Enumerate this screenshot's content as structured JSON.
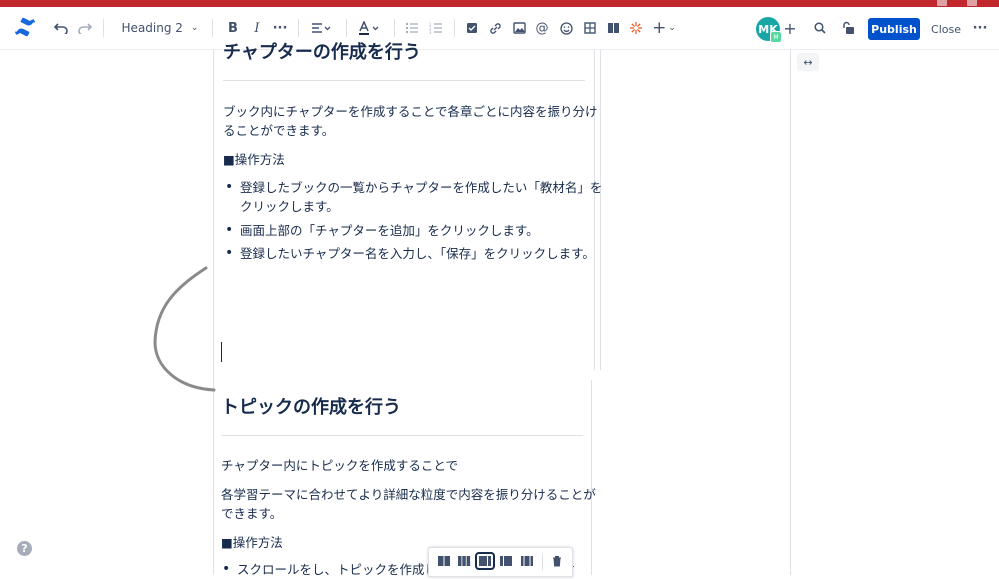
{
  "toolbar": {
    "heading_style": "Heading 2",
    "publish_label": "Publish",
    "close_label": "Close",
    "avatar_initials": "MK",
    "avatar_badge": "M"
  },
  "content": {
    "section1_title": "チャプターの作成を行う",
    "section1_intro_line1": "ブック内にチャプターを作成することで各章ごとに内容を振り分け",
    "section1_intro_line2": "ることができます。",
    "section1_ops_label": "■操作方法",
    "section1_bullets": [
      {
        "line1": "登録したブックの一覧からチャプターを作成したい「教材名」を",
        "line2": "クリックします。"
      },
      {
        "line1": "画面上部の「チャプターを追加」をクリックします。"
      },
      {
        "line1": "登録したいチャプター名を入力し、「保存」をクリックします。"
      }
    ],
    "section2_title": "トピックの作成を行う",
    "section2_intro": "チャプター内にトピックを作成することで",
    "section2_detail_line1": "各学習テーマに合わせてより詳細な粒度で内容を振り分けることが",
    "section2_detail_line2": "できます。",
    "section2_ops_label": "■操作方法",
    "section2_bullet_partial": "スクロールをし、トピックを作成したいチャプターの「教材"
  },
  "colors": {
    "accent": "#0052cc",
    "top_strip": "#c1272d",
    "avatar": "#19a6a6",
    "text": "#172b4d"
  }
}
